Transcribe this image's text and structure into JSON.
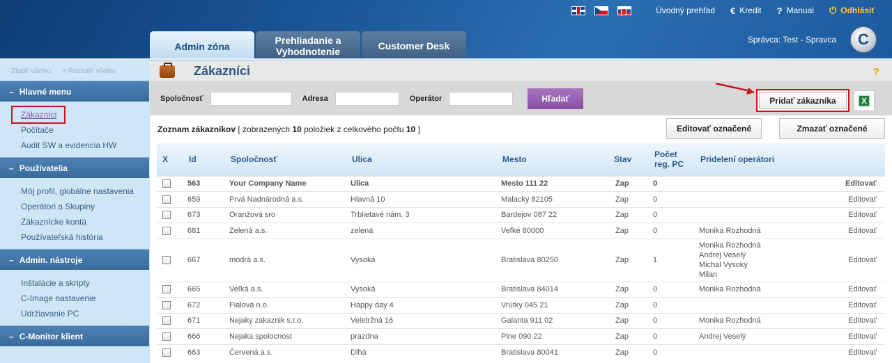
{
  "topbar": {
    "languages": [
      "flag-uk",
      "flag-cz",
      "flag-sk"
    ],
    "overview": "Úvodný prehľad",
    "credit": "Kredit",
    "credit_icon": "€",
    "manual": "Manual",
    "manual_icon": "?",
    "logout": "Odhlásiť",
    "logout_icon": "⏻"
  },
  "tabs": [
    "Admin zóna",
    "Prehliadanie a Vyhodnotenie",
    "Customer Desk"
  ],
  "admin": {
    "label": "Správca:",
    "user": "Test - Spravca"
  },
  "logo_letter": "C",
  "sidebar": {
    "collapse_all": "- Zbaliť všetko",
    "expand_all": "+ Rozbaliť všetko",
    "sections": [
      {
        "title": "Hlavné menu",
        "items": [
          "Zákazníci",
          "Počítače",
          "Audit SW a evidencia HW"
        ]
      },
      {
        "title": "Používatelia",
        "items": [
          "Môj profil, globálne nastavenia",
          "Operátori a Skupiny",
          "Zákaznícke kontá",
          "Používateľská história"
        ]
      },
      {
        "title": "Admin. nástroje",
        "items": [
          "Inštalácie a skripty",
          "C-Image nastavenie",
          "Udržiavanie PC"
        ]
      },
      {
        "title": "C-Monitor klient",
        "items": []
      }
    ]
  },
  "page": {
    "title": "Zákazníci",
    "help": "?"
  },
  "filter": {
    "company_label": "Spoločnosť",
    "address_label": "Adresa",
    "operator_label": "Operátor",
    "search_button": "Hľadať",
    "add_button": "Pridať zákazníka",
    "excel_icon": "X"
  },
  "list": {
    "prefix": "Zoznam zákazníkov",
    "info_a": " [ zobrazených ",
    "shown": "10",
    "info_b": " položiek z celkového počtu ",
    "total": "10",
    "info_c": " ]",
    "edit_selected": "Editovať označené",
    "delete_selected": "Zmazať označené"
  },
  "table": {
    "headers": [
      "X",
      "Id",
      "Spoločnosť",
      "Ulica",
      "Mesto",
      "Stav",
      "Počet reg. PC",
      "Pridelení operátori",
      ""
    ],
    "rows": [
      {
        "id": "563",
        "company": "Your Company Name",
        "street": "Ulica",
        "city": "Mesto 111 22",
        "state": "Zap",
        "pc": "0",
        "operators": [],
        "action": "Editovať",
        "bold": true
      },
      {
        "id": "659",
        "company": "Prvá Nadnárodná a.s.",
        "street": "Hlavná 10",
        "city": "Malacky 82105",
        "state": "Zap",
        "pc": "0",
        "operators": [],
        "action": "Editovať"
      },
      {
        "id": "673",
        "company": "Oranžová sro",
        "street": "Trblietavé nám. 3",
        "city": "Bardejov 087 22",
        "state": "Zap",
        "pc": "0",
        "operators": [],
        "action": "Editovať"
      },
      {
        "id": "681",
        "company": "Zelená a.s.",
        "street": "zelená",
        "city": "Veľké 80000",
        "state": "Zap",
        "pc": "0",
        "operators": [
          "Monika Rozhodná"
        ],
        "action": "Editovať"
      },
      {
        "id": "667",
        "company": "modrá a.s.",
        "street": "Vysoká",
        "city": "Bratislava 80250",
        "state": "Zap",
        "pc": "1",
        "operators": [
          "Monika Rozhodná",
          "Andrej Veselý",
          "Michal Vysoký",
          "Milan"
        ],
        "action": "Editovať"
      },
      {
        "id": "665",
        "company": "Veľká a.s.",
        "street": "Vysoká",
        "city": "Bratislava 84014",
        "state": "Zap",
        "pc": "0",
        "operators": [
          "Monika Rozhodná"
        ],
        "action": "Editovať"
      },
      {
        "id": "672",
        "company": "Fialová n.o.",
        "street": "Happy day 4",
        "city": "Vrútky 045 21",
        "state": "Zap",
        "pc": "0",
        "operators": [],
        "action": "Editovať"
      },
      {
        "id": "671",
        "company": "Nejaky zakaznik s.r.o.",
        "street": "Veletržná 16",
        "city": "Galanta 911 02",
        "state": "Zap",
        "pc": "0",
        "operators": [
          "Monika Rozhodná"
        ],
        "action": "Editovať"
      },
      {
        "id": "666",
        "company": "Nejaka spolocnost",
        "street": "prazdna",
        "city": "Plne 090 22",
        "state": "Zap",
        "pc": "0",
        "operators": [
          "Andrej Veselý"
        ],
        "action": "Editovať"
      },
      {
        "id": "663",
        "company": "Červená a.s.",
        "street": "Dlhá",
        "city": "Bratislava 80041",
        "state": "Zap",
        "pc": "0",
        "operators": [],
        "action": "Editovať"
      }
    ]
  }
}
